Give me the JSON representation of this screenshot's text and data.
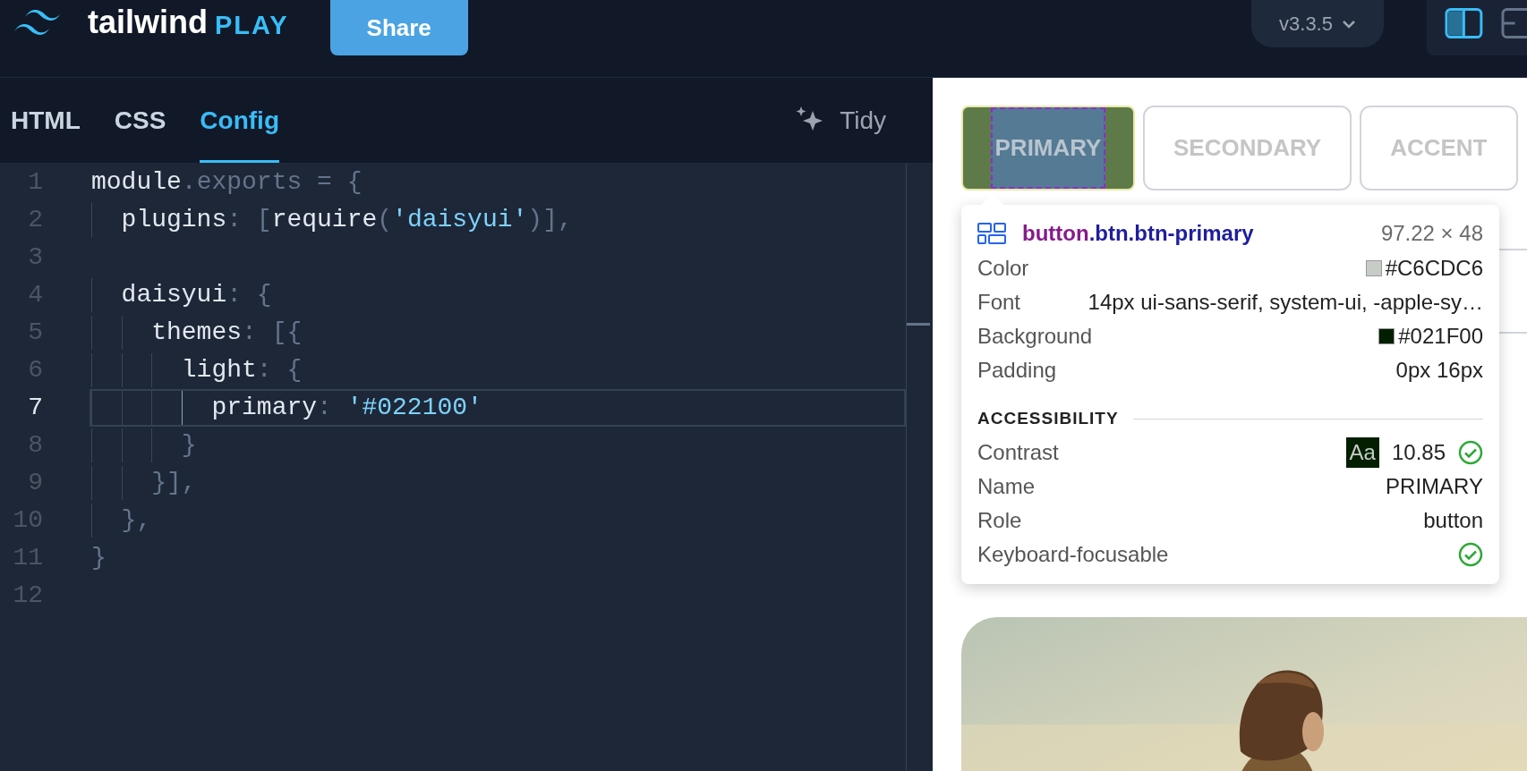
{
  "header": {
    "logo": {
      "word": "tailwind",
      "badge": "PLAY"
    },
    "share_button": "Share",
    "version": "v3.3.5"
  },
  "editor": {
    "tabs": [
      {
        "label": "HTML",
        "selected": false
      },
      {
        "label": "CSS",
        "selected": false
      },
      {
        "label": "Config",
        "selected": true
      }
    ],
    "tidy_button": "Tidy",
    "lines": [
      {
        "number": "1",
        "active": false,
        "tokens": [
          {
            "text": "module",
            "kind": "plain"
          },
          {
            "text": ".exports = {",
            "kind": "punct"
          }
        ]
      },
      {
        "number": "2",
        "active": false,
        "tokens": [
          {
            "text": "  plugins",
            "kind": "plain"
          },
          {
            "text": ": [",
            "kind": "punct"
          },
          {
            "text": "require",
            "kind": "plain"
          },
          {
            "text": "(",
            "kind": "punct"
          },
          {
            "text": "'daisyui'",
            "kind": "string"
          },
          {
            "text": ")],",
            "kind": "punct"
          }
        ]
      },
      {
        "number": "3",
        "active": false
      },
      {
        "number": "4",
        "active": false,
        "tokens": [
          {
            "text": "  daisyui",
            "kind": "plain"
          },
          {
            "text": ": {",
            "kind": "punct"
          }
        ]
      },
      {
        "number": "5",
        "active": false,
        "tokens": [
          {
            "text": "    themes",
            "kind": "plain"
          },
          {
            "text": ": [{",
            "kind": "punct"
          }
        ]
      },
      {
        "number": "6",
        "active": false,
        "tokens": [
          {
            "text": "      light",
            "kind": "plain"
          },
          {
            "text": ": {",
            "kind": "punct"
          }
        ]
      },
      {
        "number": "7",
        "active": true,
        "tokens": [
          {
            "text": "        primary",
            "kind": "plain"
          },
          {
            "text": ": ",
            "kind": "punct"
          },
          {
            "text": "'#022100'",
            "kind": "string"
          }
        ]
      },
      {
        "number": "8",
        "active": false,
        "tokens": [
          {
            "text": "      }",
            "kind": "punct"
          }
        ]
      },
      {
        "number": "9",
        "active": false,
        "tokens": [
          {
            "text": "    }],",
            "kind": "punct"
          }
        ]
      },
      {
        "number": "10",
        "active": false,
        "tokens": [
          {
            "text": "  },",
            "kind": "punct"
          }
        ]
      },
      {
        "number": "11",
        "active": false,
        "tokens": [
          {
            "text": "}",
            "kind": "punct"
          }
        ]
      },
      {
        "number": "12",
        "active": false
      }
    ]
  },
  "preview": {
    "buttons": [
      {
        "label": "PRIMARY",
        "inspected": true
      },
      {
        "label": "SECONDARY",
        "inspected": false
      },
      {
        "label": "ACCENT",
        "inspected": false
      }
    ],
    "inspector": {
      "tag": "button",
      "classes": ".btn.btn-primary",
      "size": "97.22 × 48",
      "properties": [
        {
          "name": "Color",
          "value": "#C6CDC6",
          "color": "#c6cdc6"
        },
        {
          "name": "Font",
          "value": "14px ui-sans-serif, system-ui, -apple-sy…"
        },
        {
          "name": "Background",
          "value": "#021F00",
          "color": "#021f00"
        },
        {
          "name": "Padding",
          "value": "0px 16px"
        }
      ],
      "accessibility_heading": "ACCESSIBILITY",
      "accessibility": [
        {
          "kind": "contrast",
          "name": "Contrast",
          "sample": "Aa",
          "value": "10.85",
          "passed": true
        },
        {
          "kind": "text",
          "name": "Name",
          "value": "PRIMARY"
        },
        {
          "kind": "text",
          "name": "Role",
          "value": "button"
        },
        {
          "kind": "check",
          "name": "Keyboard-focusable",
          "passed": true
        }
      ]
    }
  }
}
